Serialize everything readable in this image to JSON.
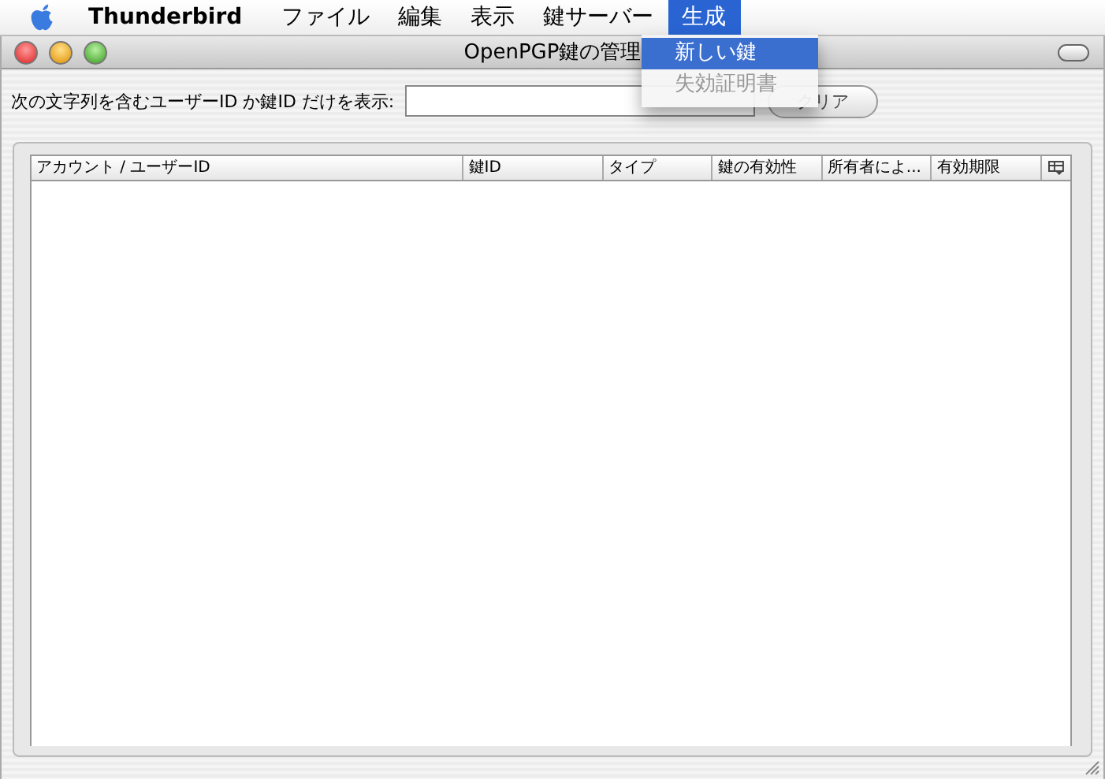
{
  "menubar": {
    "app": "Thunderbird",
    "items": [
      {
        "label": "ファイル",
        "selected": false
      },
      {
        "label": "編集",
        "selected": false
      },
      {
        "label": "表示",
        "selected": false
      },
      {
        "label": "鍵サーバー",
        "selected": false
      },
      {
        "label": "生成",
        "selected": true
      }
    ]
  },
  "menu": {
    "items": [
      {
        "label": "新しい鍵",
        "selected": true,
        "disabled": false
      },
      {
        "label": "失効証明書",
        "selected": false,
        "disabled": true
      }
    ]
  },
  "window": {
    "title": "OpenPGP鍵の管理"
  },
  "filter": {
    "label": "次の文字列を含むユーザーID か鍵ID だけを表示:",
    "button": "クリア"
  },
  "table": {
    "columns": [
      "アカウント / ユーザーID",
      "鍵ID",
      "タイプ",
      "鍵の有効性",
      "所有者によ...",
      "有効期限"
    ]
  }
}
